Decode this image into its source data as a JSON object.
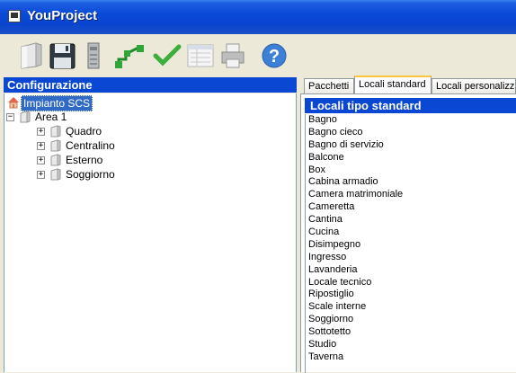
{
  "window": {
    "title": "YouProject"
  },
  "toolbar": {
    "buttons": [
      {
        "icon": "new-document-icon"
      },
      {
        "icon": "save-icon"
      },
      {
        "icon": "device-icon"
      },
      {
        "icon": "network-icon"
      },
      {
        "icon": "checkmark-icon"
      },
      {
        "icon": "list-view-icon"
      },
      {
        "icon": "print-icon"
      },
      {
        "icon": "help-icon"
      }
    ]
  },
  "left_panel": {
    "header": "Configurazione",
    "tree": {
      "root": "Impianto SCS",
      "area": "Area 1",
      "children": [
        "Quadro",
        "Centralino",
        "Esterno",
        "Soggiorno"
      ]
    }
  },
  "right_panel": {
    "tabs": [
      "Pacchetti",
      "Locali standard",
      "Locali personalizza"
    ],
    "active_tab": "Locali standard",
    "list_header": "Locali tipo standard",
    "items": [
      "Bagno",
      "Bagno cieco",
      "Bagno di servizio",
      "Balcone",
      "Box",
      "Cabina armadio",
      "Camera matrimoniale",
      "Cameretta",
      "Cantina",
      "Cucina",
      "Disimpegno",
      "Ingresso",
      "Lavanderia",
      "Locale tecnico",
      "Ripostiglio",
      "Scale interne",
      "Soggiorno",
      "Sottotetto",
      "Studio",
      "Taverna"
    ]
  }
}
